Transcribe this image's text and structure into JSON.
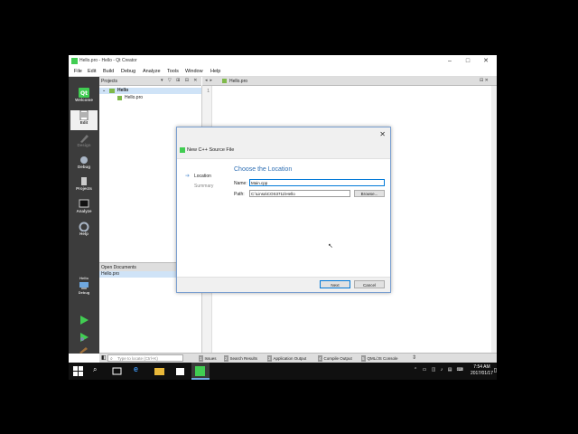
{
  "window": {
    "title": "Hello.pro - Hello - Qt Creator",
    "menu": [
      "File",
      "Edit",
      "Build",
      "Debug",
      "Analyze",
      "Tools",
      "Window",
      "Help"
    ]
  },
  "modes": [
    {
      "label": "Welcome"
    },
    {
      "label": "Edit"
    },
    {
      "label": "Design"
    },
    {
      "label": "Debug"
    },
    {
      "label": "Projects"
    },
    {
      "label": "Analyze"
    },
    {
      "label": "Help"
    }
  ],
  "kit": {
    "project": "Hello",
    "mode": "Debug"
  },
  "projects_panel": {
    "header": "Projects",
    "tree": [
      {
        "label": "Hello"
      },
      {
        "label": "Hello.pro"
      }
    ]
  },
  "open_documents": {
    "header": "Open Documents",
    "items": [
      "Hello.pro"
    ]
  },
  "editor": {
    "file": "Hello.pro",
    "line": "1"
  },
  "output_bar": {
    "locator_placeholder": "Type to locate (Ctrl+K)",
    "tabs": [
      {
        "num": "1",
        "label": "Issues"
      },
      {
        "num": "2",
        "label": "Search Results"
      },
      {
        "num": "3",
        "label": "Application Output"
      },
      {
        "num": "4",
        "label": "Compile Output"
      },
      {
        "num": "5",
        "label": "QML/JS Console"
      }
    ]
  },
  "dialog": {
    "title": "New C++ Source File",
    "steps": [
      "Location",
      "Summary"
    ],
    "heading": "Choose the Location",
    "name_label": "Name:",
    "name_value": "Main.cpp",
    "path_label": "Path:",
    "path_value": "C:\\Linsa\\COS3711\\Hello",
    "browse": "Browse...",
    "next": "Next",
    "cancel": "Cancel"
  },
  "taskbar": {
    "time": "7:54 AM",
    "date": "2017/01/17"
  },
  "colors": {
    "accent": "#0078d7",
    "qt_green": "#41cd52",
    "sidebar": "#3c3c3c",
    "heading": "#2e6fb4"
  }
}
